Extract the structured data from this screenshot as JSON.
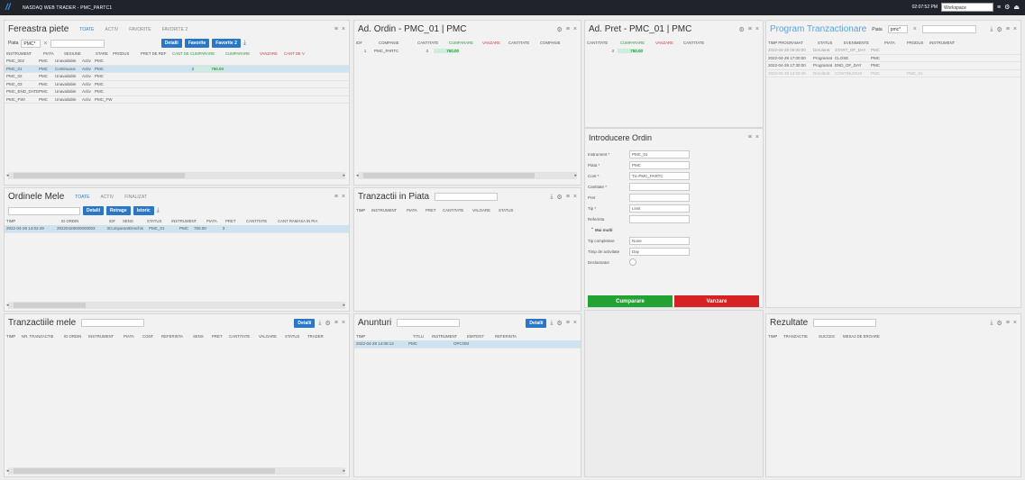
{
  "app": {
    "title": "NASDAQ WEB TRADER - PMC_PARTC1",
    "time": "02:07:52 PM",
    "workspace": "Workspace"
  },
  "market": {
    "title": "Fereastra piete",
    "tabs": [
      "TOATE",
      "ACTIV",
      "FAVORITE",
      "FAVORITE 2"
    ],
    "filter_label": "Piata",
    "filter_value": "PMC*",
    "buttons": [
      "Detalii",
      "Favorite",
      "Favorite 2"
    ],
    "columns": [
      "INSTRUMENT",
      "PIATA",
      "SESIUNE",
      "STARE",
      "PRODUS",
      "PRET DE REF",
      "CANT DE CUMPARARE",
      "CUMPARARE",
      "VANZARE",
      "CANT DE V"
    ],
    "rows": [
      [
        "PMC_002",
        "PMC",
        "Unavailable",
        "Activ",
        "PMC",
        "",
        "",
        "",
        "",
        ""
      ],
      [
        "PMC_01",
        "PMC",
        "Continuous",
        "Activ",
        "PMC",
        "",
        "3",
        "750.00",
        "",
        ""
      ],
      [
        "PMC_02",
        "PMC",
        "Unavailable",
        "Activ",
        "PMC",
        "",
        "",
        "",
        "",
        ""
      ],
      [
        "PMC_03",
        "PMC",
        "Unavailable",
        "Activ",
        "PMC",
        "",
        "",
        "",
        "",
        ""
      ],
      [
        "PMC_END_DATE",
        "PMC",
        "Unavailable",
        "Activ",
        "PMC",
        "",
        "",
        "",
        "",
        ""
      ],
      [
        "PMC_FWI",
        "PMC",
        "Unavailable",
        "Activ",
        "PMC_FW",
        "",
        "",
        "",
        "",
        ""
      ]
    ]
  },
  "adordin": {
    "title": "Ad. Ordin - PMC_01 | PMC",
    "columns": [
      "ID#",
      "COMPANIE",
      "CANTITATE",
      "CUMPARARE",
      "VANZARE",
      "CANTITATE",
      "COMPANIE"
    ],
    "row": [
      "1",
      "PMC_PARTC",
      "3",
      "750.00",
      "",
      "",
      ""
    ]
  },
  "adpret": {
    "title": "Ad. Pret - PMC_01 | PMC",
    "columns": [
      "CANTITATE",
      "CUMPARARE",
      "VANZARE",
      "CANTITATE"
    ],
    "row": [
      "3",
      "750.00",
      "",
      ""
    ]
  },
  "program": {
    "title": "Program Tranzactionare",
    "filter_label": "Piata",
    "filter_value": "pmc*",
    "columns": [
      "TIMP PROGRAMAT",
      "STATUS",
      "EVENIMENTE",
      "PIATA",
      "PRODUS",
      "INSTRUMENT"
    ],
    "rows": [
      [
        "2022-04-28 00:00:00",
        "Derularat",
        "START_OF_DAY",
        "PMC",
        "",
        ""
      ],
      [
        "2022-04-28 17:00:00",
        "Programat",
        "CLOSE",
        "PMC",
        "",
        ""
      ],
      [
        "2022-04-28 17:30:00",
        "Programat",
        "END_OF_DAY",
        "PMC",
        "",
        ""
      ],
      [
        "2022-04-28 14:02:49",
        "Derularat",
        "CONTINUOUS",
        "PMC",
        "",
        "PMC_01"
      ]
    ]
  },
  "ordine": {
    "title": "Ordinele Mele",
    "tabs": [
      "TOATE",
      "ACTIV",
      "FINALIZAT"
    ],
    "buttons": [
      "Detalii",
      "Retrage",
      "Istoric"
    ],
    "columns": [
      "TIMP",
      "ID ORDIN",
      "ID#",
      "SENS",
      "STATUS",
      "INSTRUMENT",
      "PIATA",
      "PRET",
      "CANTITATE",
      "CANT RAMASA IN PIA"
    ],
    "row": [
      "2022-04-28 14:02:49",
      "20220428000000003",
      "3",
      "Cumparare",
      "Deschis",
      "PMC_01",
      "PMC",
      "750.00",
      "3",
      ""
    ]
  },
  "tranzactii_piata": {
    "title": "Tranzactii in Piata",
    "columns": [
      "TIMP",
      "INSTRUMENT",
      "PIATA",
      "PRET",
      "CANTITATE",
      "VALOARE",
      "STATUS"
    ]
  },
  "introducere": {
    "title": "Introducere Ordin",
    "fields": [
      {
        "label": "Instrument *",
        "value": "PMC_01"
      },
      {
        "label": "Piata *",
        "value": "PMC"
      },
      {
        "label": "Cont *",
        "value": "Tic-PMC_PARTC"
      },
      {
        "label": "Cantitate *",
        "value": ""
      },
      {
        "label": "Pret",
        "value": ""
      },
      {
        "label": "Tip *",
        "value": "Limit"
      },
      {
        "label": "Referinta",
        "value": ""
      }
    ],
    "more": "Mai multi",
    "fields2": [
      {
        "label": "Tip completare",
        "value": "None"
      },
      {
        "label": "Timp de activitate",
        "value": "Day"
      },
      {
        "label": "Declansator",
        "value": ""
      }
    ],
    "buy": "Cumparare",
    "sell": "Vanzare"
  },
  "tranzactiile": {
    "title": "Tranzactiile mele",
    "button": "Detalii",
    "columns": [
      "TIMP",
      "NR. TRANZACTIE",
      "ID ORDIN",
      "INSTRUMENT",
      "PIATA",
      "CONT",
      "REFERINTA",
      "SENS",
      "PRET",
      "CANTITATE",
      "VALOARE",
      "STATUS",
      "TRADER"
    ]
  },
  "anunturi": {
    "title": "Anunturi",
    "button": "Detalii",
    "columns": [
      "TIMP",
      "TITLU",
      "INSTRUMENT",
      "EMITENT",
      "REFERINTA"
    ],
    "row": [
      "2022-04-28 14:08:14",
      "PMC",
      "",
      "OPCOM",
      ""
    ]
  },
  "rezultate": {
    "title": "Rezultate",
    "columns": [
      "TIMP",
      "TRANZACTIE",
      "SUCCES",
      "MESAJ DE EROARE"
    ]
  },
  "colors": {
    "accent": "#2a77c8",
    "buy": "#22a233",
    "sell": "#d62222",
    "selected": "#cde3f0"
  }
}
